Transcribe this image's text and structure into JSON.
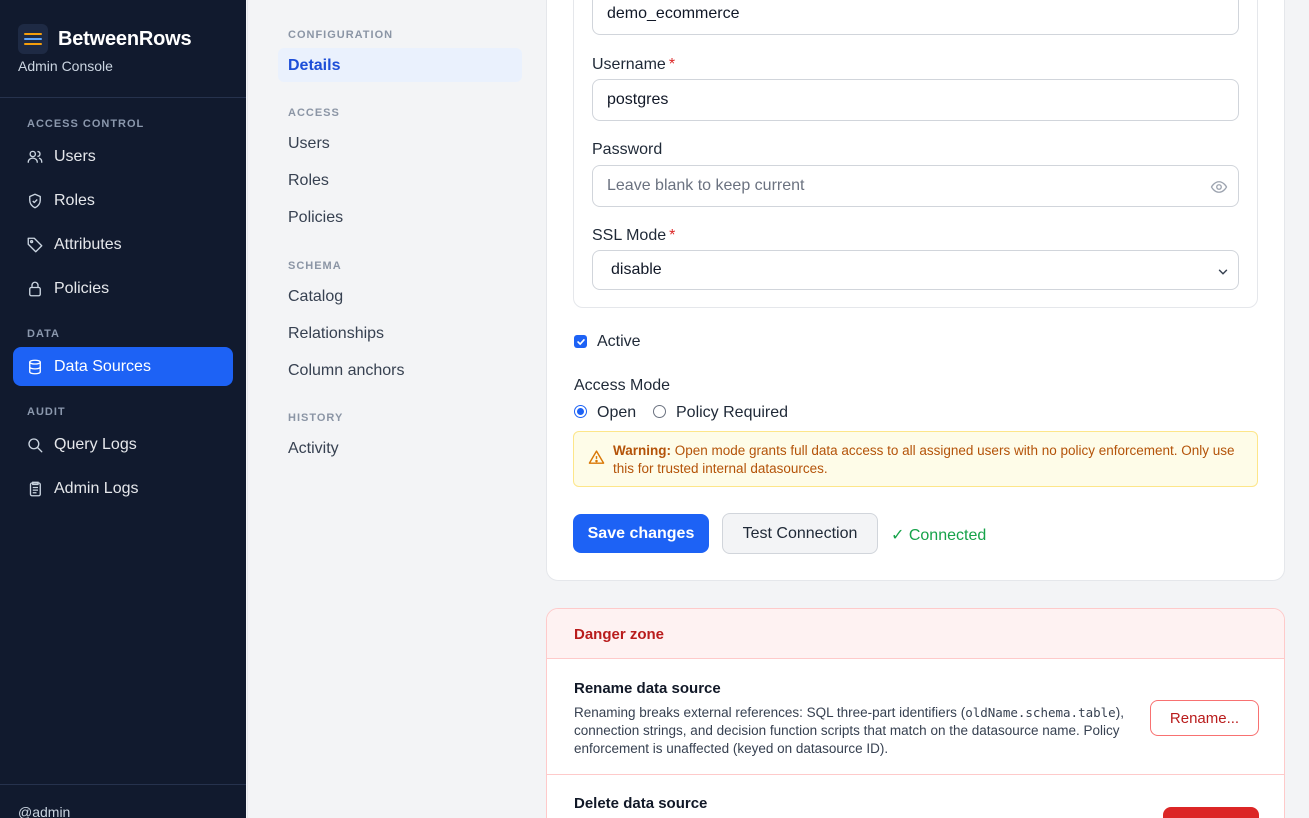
{
  "sidebar": {
    "brand_title": "BetweenRows",
    "brand_subtitle": "Admin Console",
    "sections": {
      "access_control": "ACCESS CONTROL",
      "data": "DATA",
      "audit": "AUDIT"
    },
    "items": {
      "users": "Users",
      "roles": "Roles",
      "attributes": "Attributes",
      "policies": "Policies",
      "data_sources": "Data Sources",
      "query_logs": "Query Logs",
      "admin_logs": "Admin Logs"
    },
    "active_item": "Data Sources",
    "user": "@admin",
    "accent_color": "#1d62f5"
  },
  "subnav": {
    "sections": {
      "configuration": "CONFIGURATION",
      "access": "ACCESS",
      "schema": "SCHEMA",
      "history": "HISTORY"
    },
    "items": {
      "details": "Details",
      "users": "Users",
      "roles": "Roles",
      "policies": "Policies",
      "catalog": "Catalog",
      "relationships": "Relationships",
      "column_anchors": "Column anchors",
      "activity": "Activity"
    }
  },
  "form": {
    "database_value": "demo_ecommerce",
    "username_label": "Username",
    "username_value": "postgres",
    "password_label": "Password",
    "password_placeholder": "Leave blank to keep current",
    "ssl_label": "SSL Mode",
    "ssl_value": "disable",
    "required_marker": "*",
    "active_label": "Active",
    "active_checked": true,
    "access_mode_label": "Access Mode",
    "access_mode_options": [
      "Open",
      "Policy Required"
    ],
    "access_mode_selected": "Open",
    "warning_strong": "Warning:",
    "warning_text": " Open mode grants full data access to all assigned users with no policy enforcement. Only use this for trusted internal datasources.",
    "save_label": "Save changes",
    "test_label": "Test Connection",
    "status_text": "✓ Connected"
  },
  "danger": {
    "title": "Danger zone",
    "rename_title": "Rename data source",
    "rename_desc_1": "Renaming breaks external references: SQL three-part identifiers (",
    "rename_desc_code": "oldName.schema.table",
    "rename_desc_2": "), connection strings, and decision function scripts that match on the datasource name. Policy enforcement is unaffected (keyed on datasource ID).",
    "rename_button": "Rename...",
    "delete_title": "Delete data source"
  },
  "icons": {
    "menu": "hamburger-icon",
    "users": "users-icon",
    "roles": "shield-icon",
    "attributes": "tag-icon",
    "policies": "lock-icon",
    "data_sources": "database-icon",
    "query_logs": "search-icon",
    "admin_logs": "clipboard-icon",
    "password": "eye-icon",
    "ssl": "chevron-down-icon",
    "warning": "warning-icon"
  }
}
